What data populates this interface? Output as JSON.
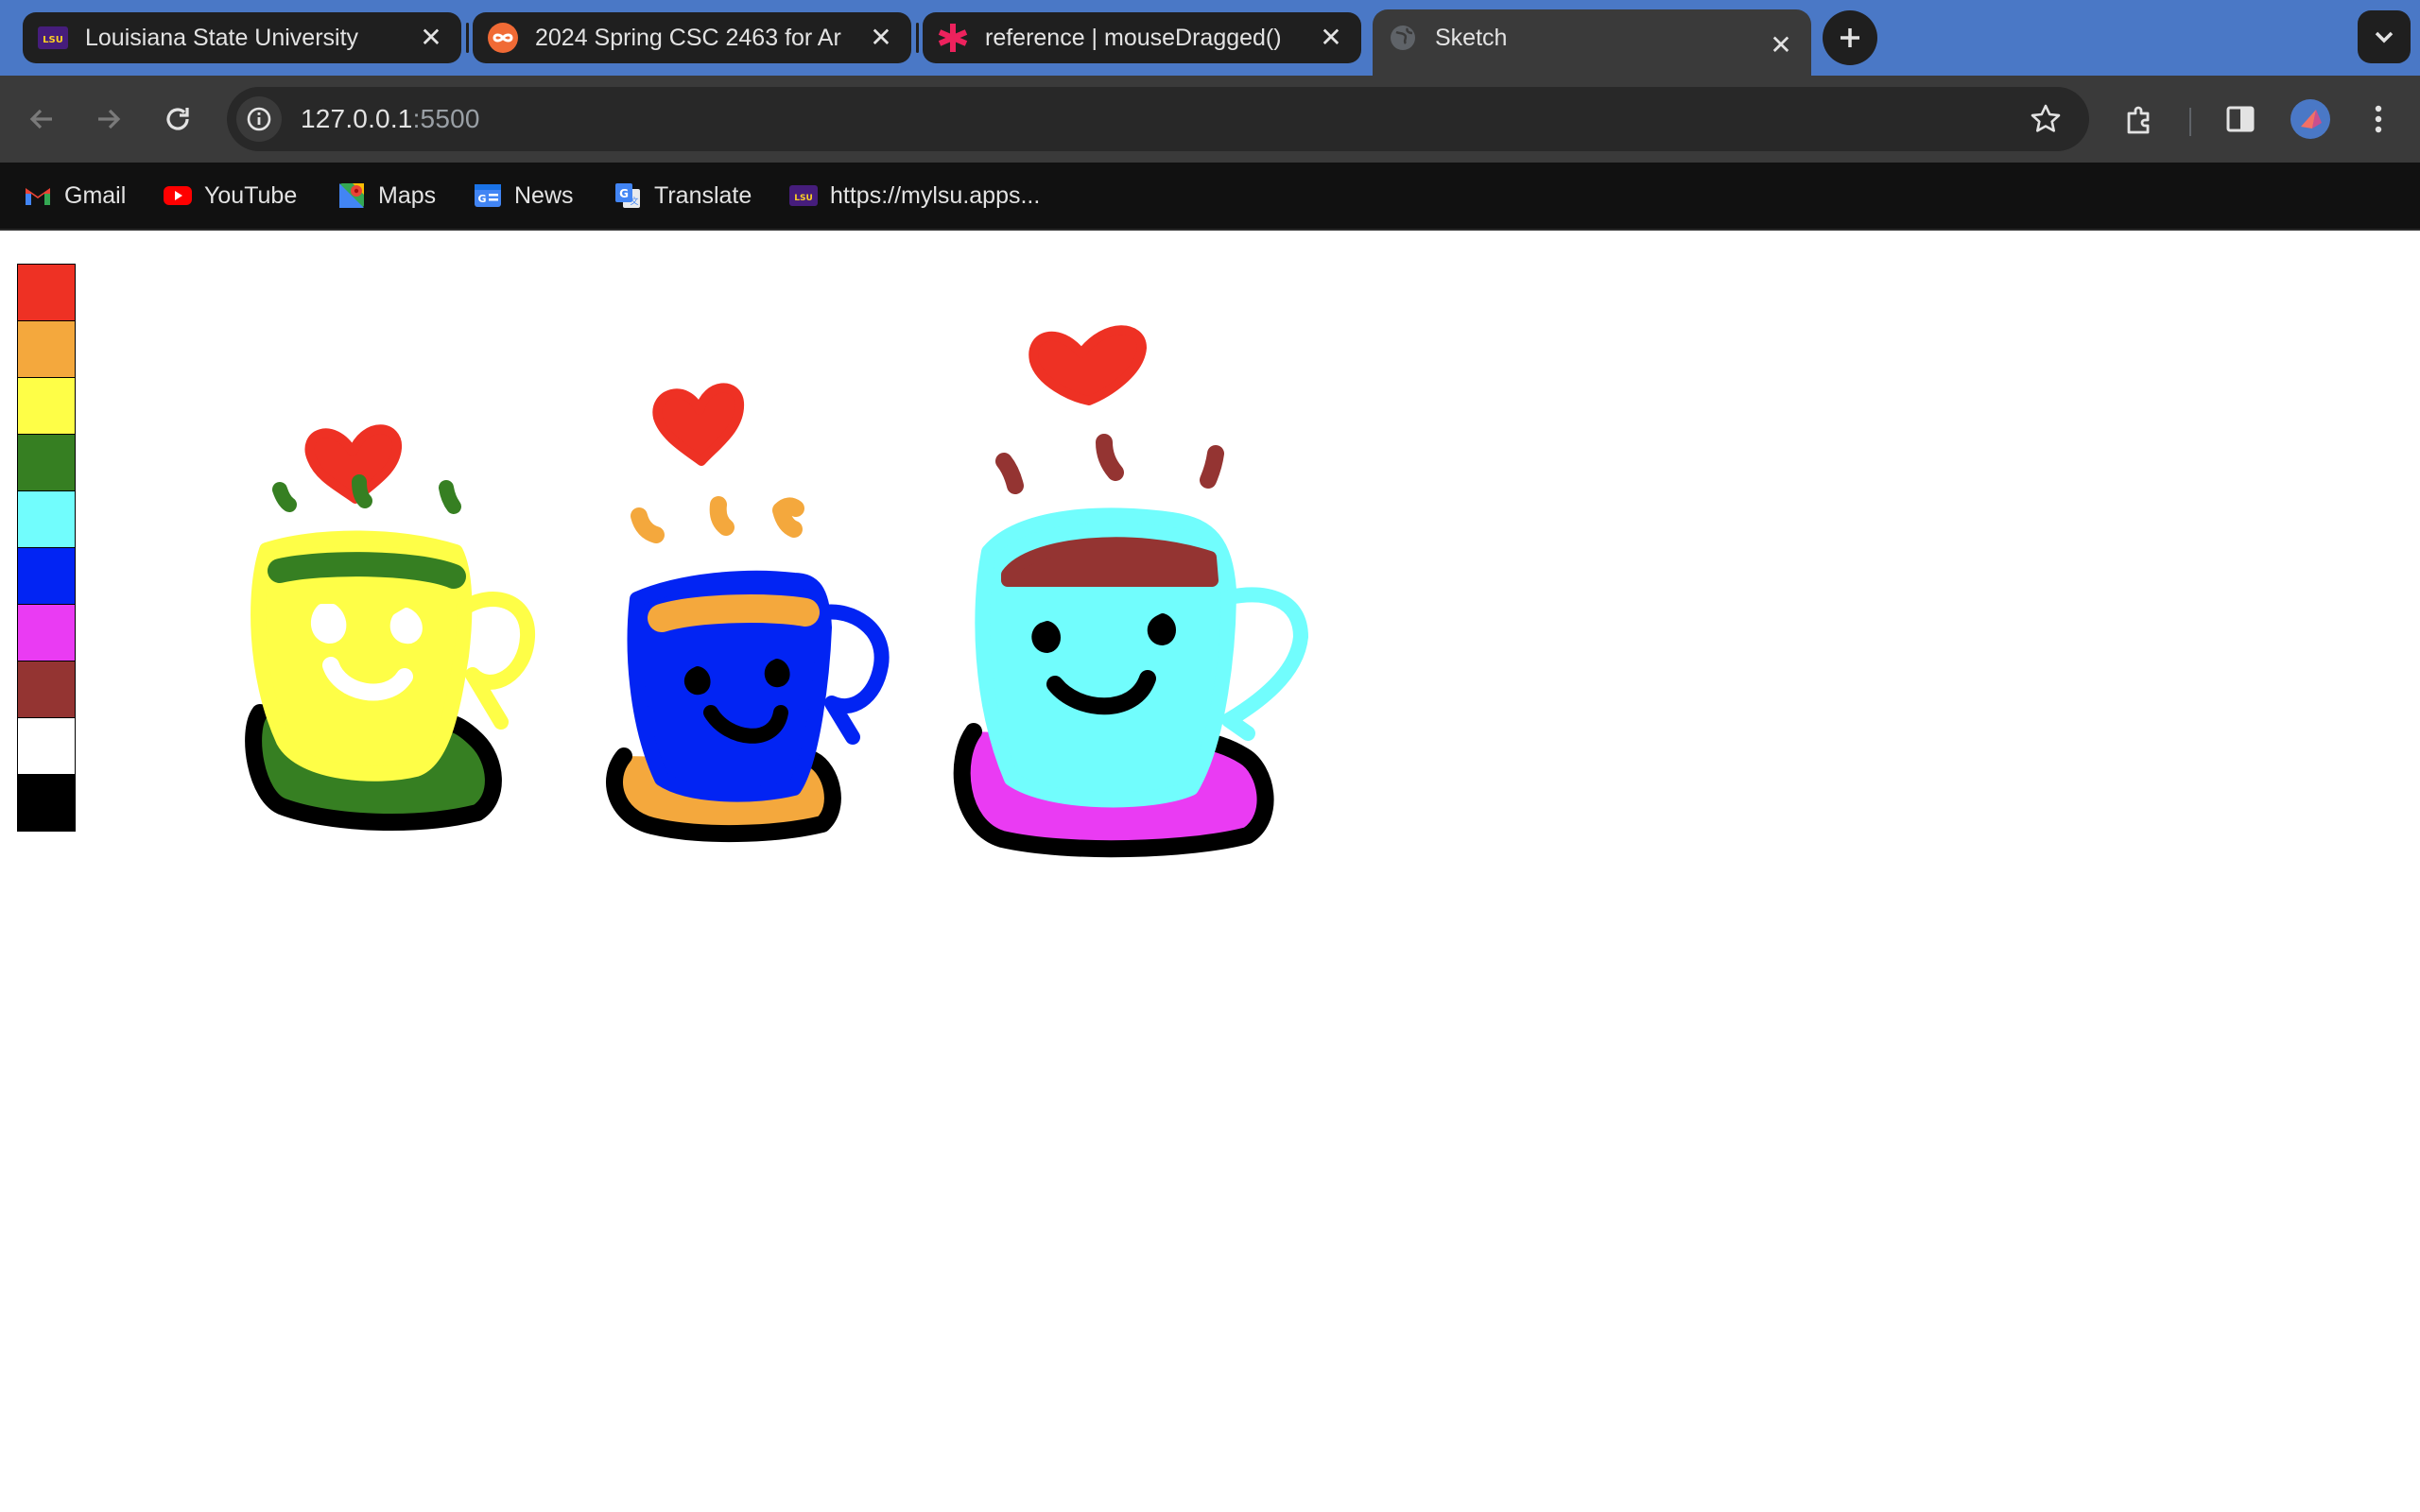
{
  "browser": {
    "tabs": [
      {
        "title": "Louisiana State University",
        "icon": "lsu-icon",
        "active": false
      },
      {
        "title": "2024 Spring CSC 2463 for Ar",
        "icon": "infinity-icon",
        "active": false
      },
      {
        "title": "reference | mouseDragged()",
        "icon": "p5-asterisk-icon",
        "active": false
      },
      {
        "title": "Sketch",
        "icon": "globe-icon",
        "active": true
      }
    ],
    "address": {
      "host": "127.0.0.1",
      "port": ":5500"
    },
    "bookmarks": [
      {
        "label": "Gmail",
        "icon": "gmail-icon"
      },
      {
        "label": "YouTube",
        "icon": "youtube-icon"
      },
      {
        "label": "Maps",
        "icon": "maps-icon"
      },
      {
        "label": "News",
        "icon": "news-icon"
      },
      {
        "label": "Translate",
        "icon": "translate-icon"
      },
      {
        "label": "https://mylsu.apps...",
        "icon": "lsu-icon"
      }
    ],
    "colors": {
      "tabstrip": "#4a78c6",
      "toolbar": "#3a3a3a",
      "omnibox": "#282828",
      "bookmarks_bar": "#111111"
    }
  },
  "sketch": {
    "palette": [
      {
        "name": "red",
        "color": "#ee3124"
      },
      {
        "name": "orange",
        "color": "#f4a83d"
      },
      {
        "name": "yellow",
        "color": "#fefe47"
      },
      {
        "name": "green",
        "color": "#367f22"
      },
      {
        "name": "cyan",
        "color": "#71fdfd"
      },
      {
        "name": "blue",
        "color": "#0224f3"
      },
      {
        "name": "magenta",
        "color": "#ea3bf3"
      },
      {
        "name": "brown",
        "color": "#943432"
      },
      {
        "name": "white",
        "color": "#ffffff"
      },
      {
        "name": "black",
        "color": "#000000"
      }
    ],
    "drawings": [
      {
        "name": "yellow-cup",
        "cup": "yellow",
        "liquid": "green",
        "saucer": "green",
        "steam": "green",
        "heart": "red"
      },
      {
        "name": "blue-cup",
        "cup": "blue",
        "liquid": "orange",
        "saucer": "orange",
        "steam": "orange",
        "heart": "red"
      },
      {
        "name": "cyan-cup",
        "cup": "cyan",
        "liquid": "brown",
        "saucer": "magenta",
        "steam": "brown",
        "heart": "red"
      }
    ]
  }
}
